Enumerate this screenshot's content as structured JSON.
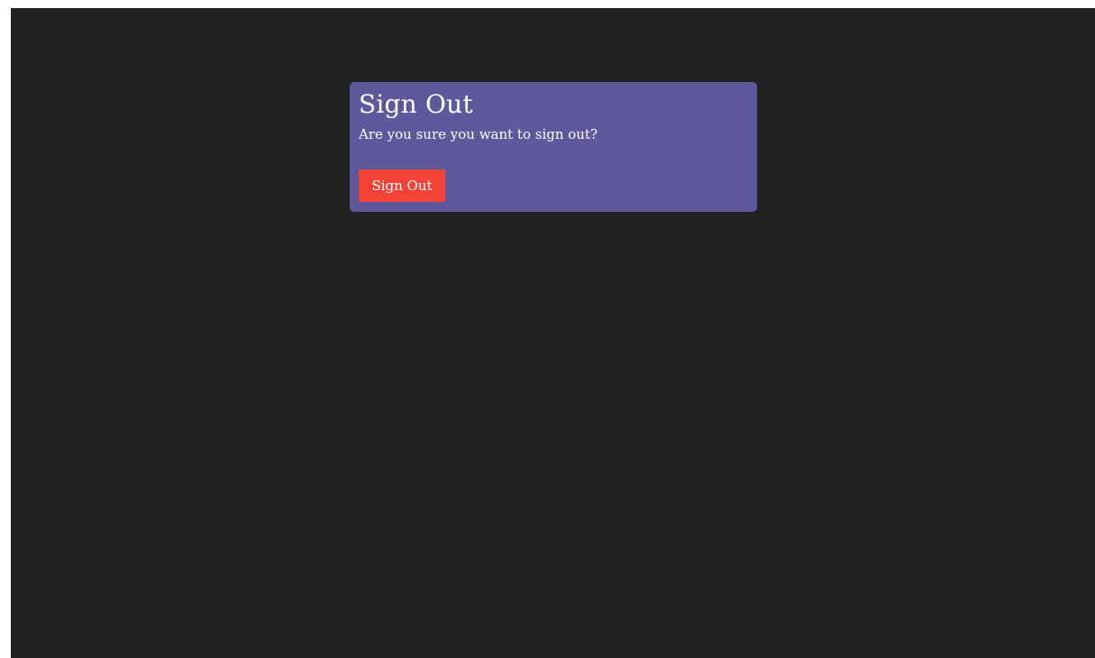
{
  "dialog": {
    "title": "Sign Out",
    "message": "Are you sure you want to sign out?",
    "confirm_label": "Sign Out"
  },
  "colors": {
    "background": "#222222",
    "dialog": "#5e589c",
    "confirm_button": "#f44336",
    "text": "#ffffff"
  }
}
